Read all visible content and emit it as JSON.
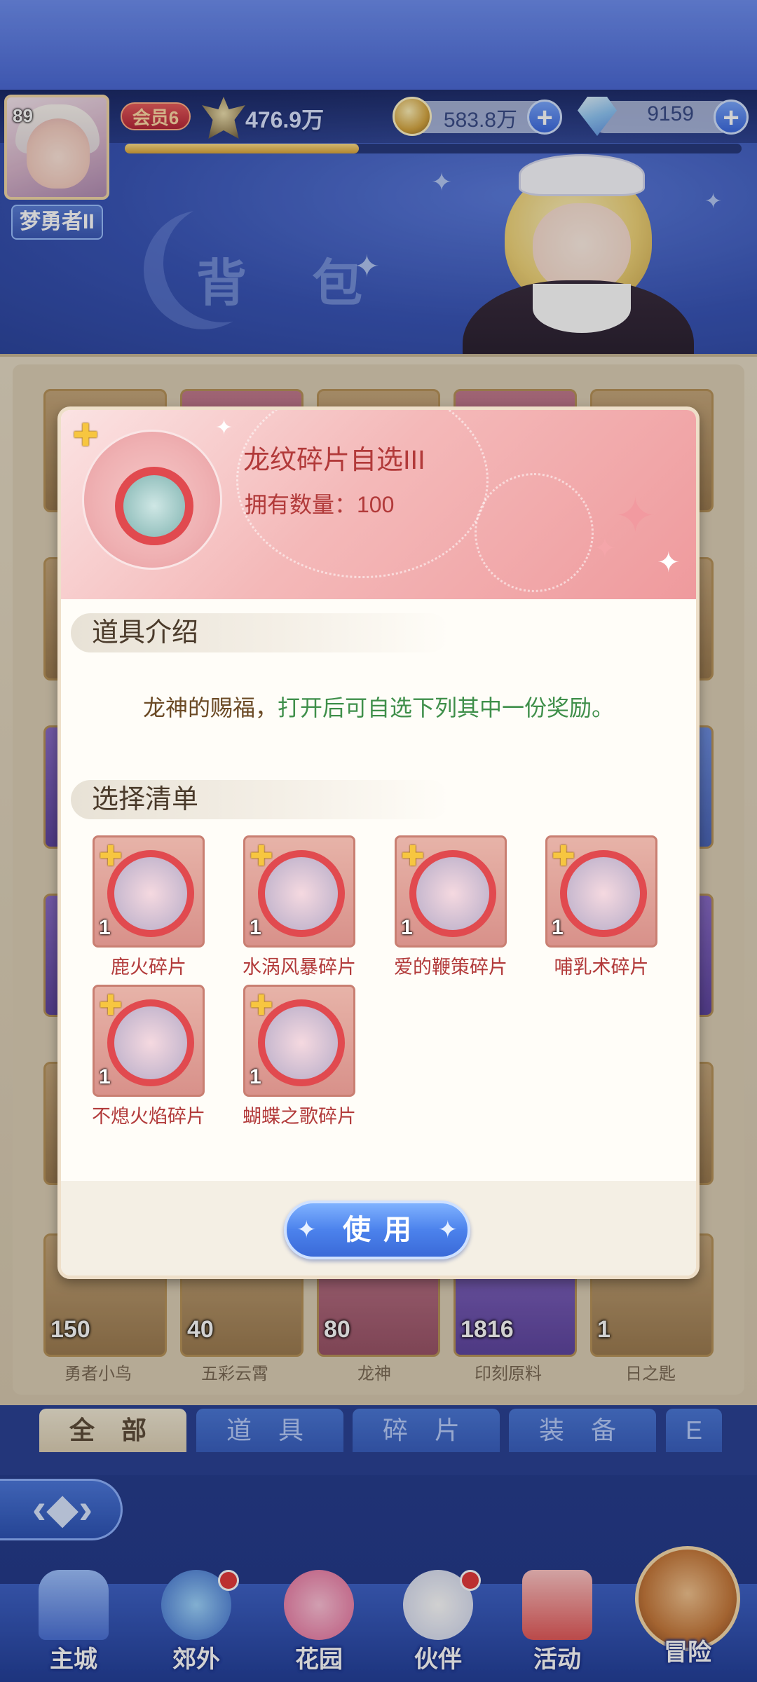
{
  "player": {
    "level": "89",
    "nickname": "梦勇者II",
    "vip": "会员6",
    "power": "476.9万",
    "exp_progress": 0.38
  },
  "currency": {
    "gold": "583.8万",
    "gems": "9159"
  },
  "page_title": "背 包",
  "inventory_bottom_row": [
    {
      "count": "150",
      "name": "勇者小鸟"
    },
    {
      "count": "40",
      "name": "五彩云霄"
    },
    {
      "count": "80",
      "name": "龙神"
    },
    {
      "count": "1816",
      "name": "印刻原料"
    },
    {
      "count": "1",
      "name": "日之匙"
    }
  ],
  "tabs": [
    "全 部",
    "道 具",
    "碎 片",
    "装 备",
    "E"
  ],
  "nav": [
    "主城",
    "郊外",
    "花园",
    "伙伴",
    "活动",
    "冒险"
  ],
  "modal": {
    "item_name": "龙纹碎片自选III",
    "count_text": "拥有数量：100",
    "section_intro": "道具介绍",
    "desc_a": "龙神的赐福，",
    "desc_b": "打开后可自选下列其中一份奖励。",
    "section_list": "选择清单",
    "rewards": [
      {
        "name": "鹿火碎片",
        "count": "1"
      },
      {
        "name": "水涡风暴碎片",
        "count": "1"
      },
      {
        "name": "爱的鞭策碎片",
        "count": "1"
      },
      {
        "name": "哺乳术碎片",
        "count": "1"
      },
      {
        "name": "不熄火焰碎片",
        "count": "1"
      },
      {
        "name": "蝴蝶之歌碎片",
        "count": "1"
      }
    ],
    "use_label": "使用"
  },
  "colors": {
    "accent_red": "#b23a3a",
    "desc_green": "#3f8f4a",
    "button_blue": "#4c82ec"
  }
}
